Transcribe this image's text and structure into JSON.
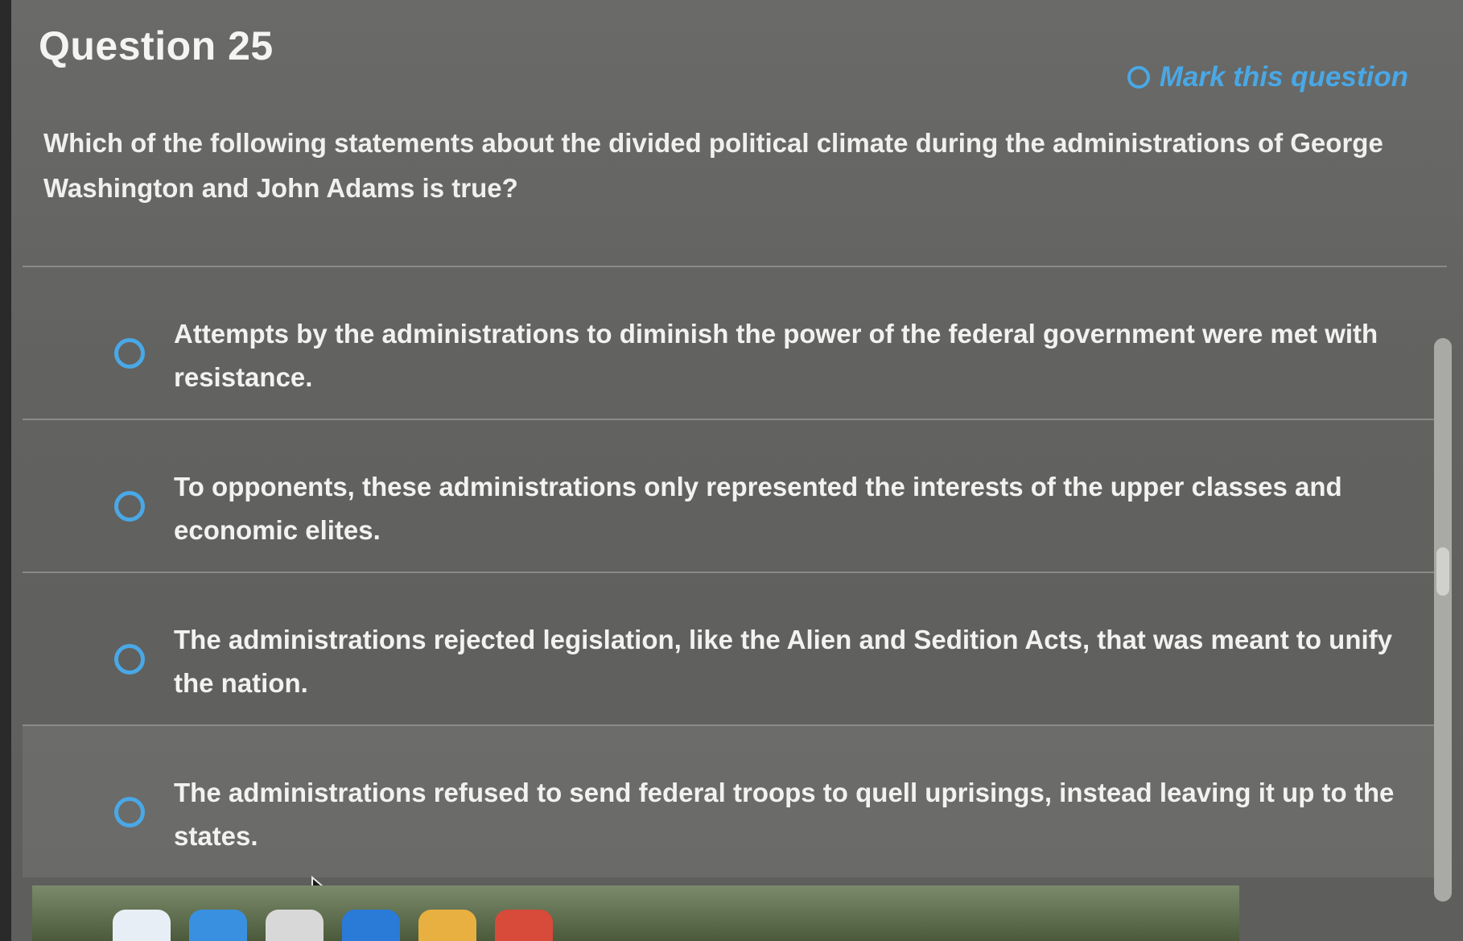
{
  "question": {
    "title": "Question 25",
    "mark_label": "Mark this question",
    "prompt": "Which of the following statements about the divided political climate during the administrations of George Washington and John Adams is true?",
    "options": [
      {
        "text": "Attempts by the administrations to diminish the power of the federal government were met with resistance."
      },
      {
        "text": "To opponents, these administrations only represented the interests of the upper classes and economic elites."
      },
      {
        "text": "The administrations rejected legislation, like the Alien and Sedition Acts, that was meant to unify the nation."
      },
      {
        "text": "The administrations refused to send federal troops to quell uprisings, instead leaving it up to the states."
      }
    ]
  },
  "colors": {
    "accent": "#49a8e6",
    "panel_bg": "#646462",
    "text": "#f2f2f0"
  },
  "icons": {
    "mark_icon": "radio-ring-icon",
    "option_icon": "radio-ring-icon",
    "cursor": "mouse-pointer-icon"
  }
}
